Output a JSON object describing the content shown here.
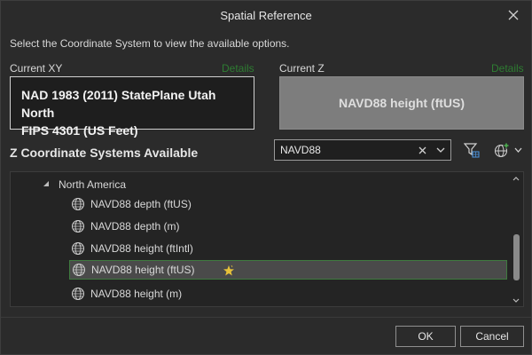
{
  "dialog": {
    "title": "Spatial Reference",
    "instruction": "Select the Coordinate System to view the available options."
  },
  "current_xy": {
    "label": "Current XY",
    "details_label": "Details",
    "value_line1": "NAD 1983 (2011) StatePlane Utah North",
    "value_line2": "FIPS 4301 (US Feet)"
  },
  "current_z": {
    "label": "Current Z",
    "details_label": "Details",
    "value": "NAVD88 height (ftUS)"
  },
  "z_systems": {
    "heading": "Z Coordinate Systems Available",
    "search_value": "NAVD88",
    "tree": {
      "group": "North America",
      "items": [
        {
          "label": "NAVD88 depth (ftUS)",
          "icon": "globe-icon",
          "selected": false
        },
        {
          "label": "NAVD88 depth (m)",
          "icon": "globe-icon",
          "selected": false
        },
        {
          "label": "NAVD88 height (ftIntl)",
          "icon": "globe-icon",
          "selected": false
        },
        {
          "label": "NAVD88 height (ftUS)",
          "icon": "globe-icon",
          "selected": true,
          "favorite_icon": "star-icon"
        },
        {
          "label": "NAVD88 height (m)",
          "icon": "globe-icon",
          "selected": false
        }
      ]
    }
  },
  "buttons": {
    "ok": "OK",
    "cancel": "Cancel"
  },
  "colors": {
    "background": "#2b2b2b",
    "details_link": "#2e7d32",
    "selection_border": "#3f7a3f",
    "z_box": "#7d7d7d",
    "star": "#e6c13a"
  }
}
